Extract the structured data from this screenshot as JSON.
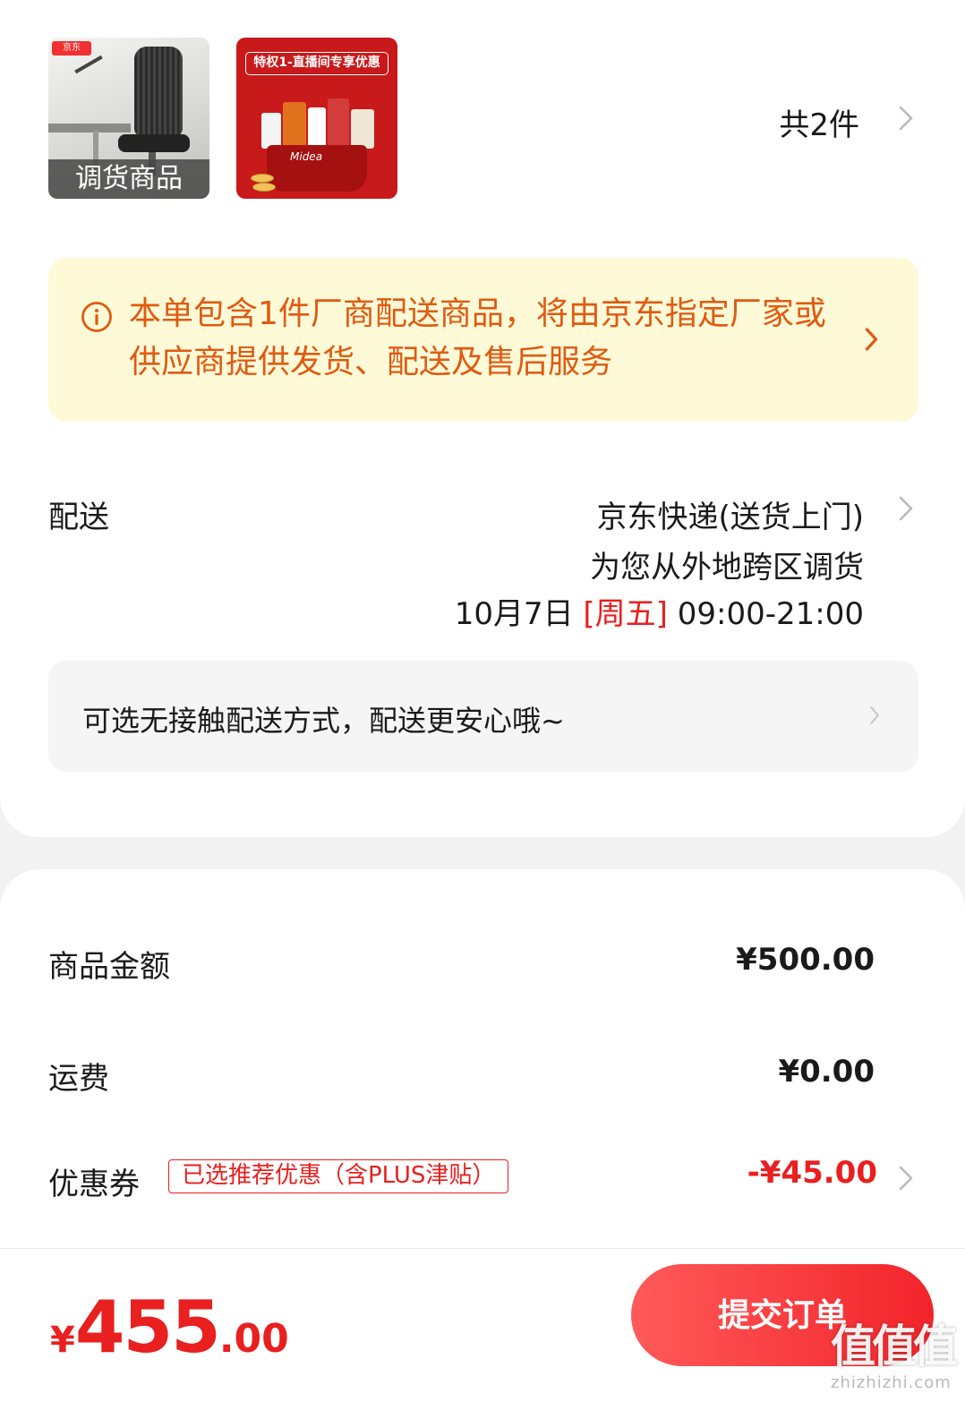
{
  "order_items": {
    "products": [
      {
        "name": "office-chair",
        "caption": "调货商品",
        "badge": "京东"
      },
      {
        "name": "midea-gift-box",
        "promo": "特权1-直播间专享优惠",
        "brand": "Midea"
      }
    ],
    "count_label": "共2件"
  },
  "notice": {
    "message": "本单包含1件厂商配送商品，将由京东指定厂家或供应商提供发货、配送及售后服务",
    "color": "#e05a10",
    "background": "#fefad8"
  },
  "shipping": {
    "label": "配送",
    "method": "京东快递(送货上门)",
    "note": "为您从外地跨区调货",
    "date": "10月7日",
    "weekday": "[周五]",
    "time": "09:00-21:00"
  },
  "contactless": {
    "text": "可选无接触配送方式，配送更安心哦~"
  },
  "summary": {
    "goods_label": "商品金额",
    "goods_value": "¥500.00",
    "freight_label": "运费",
    "freight_value": "¥0.00",
    "coupon_label": "优惠券",
    "coupon_tag": "已选推荐优惠（含PLUS津贴）",
    "coupon_value": "-¥45.00"
  },
  "footer": {
    "currency": "¥",
    "total_int": "455",
    "total_dec": ".00",
    "submit_label": "提交订单",
    "accent": "#e8201f"
  },
  "watermark": {
    "main": "值值值",
    "sub": "zhizhizhi.com"
  }
}
